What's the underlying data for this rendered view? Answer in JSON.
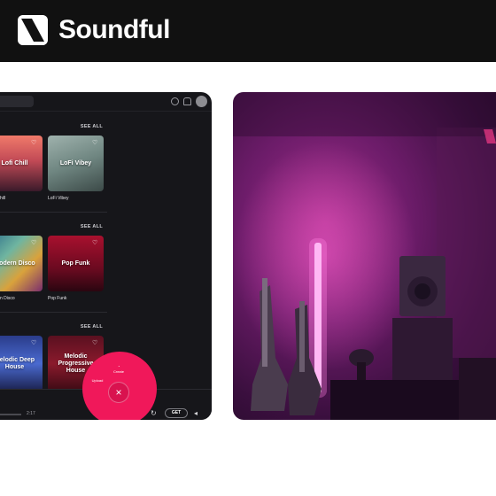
{
  "brand": {
    "name": "Soundful",
    "logo_icon": "soundful-s-logo"
  },
  "app": {
    "top_bar": {
      "icons": [
        "help-icon",
        "bell-icon",
        "avatar"
      ]
    },
    "sections": [
      {
        "see_all": "SEE ALL",
        "cards": [
          {
            "title": "Lofi Chill",
            "caption": "hill"
          },
          {
            "title": "LoFi Vibey",
            "caption": "LoFi Vibey"
          }
        ]
      },
      {
        "see_all": "SEE ALL",
        "cards": [
          {
            "title": "Modern Disco",
            "caption": "n Disco"
          },
          {
            "title": "Pop Funk",
            "caption": "Pop Funk"
          }
        ]
      },
      {
        "see_all": "SEE ALL",
        "cards": [
          {
            "title": "Melodic Deep House",
            "caption": ""
          },
          {
            "title": "Melodic Progressive House",
            "caption": ""
          }
        ]
      }
    ],
    "player": {
      "time": "2:17",
      "get_label": "GET"
    },
    "fab": {
      "upper_label": "Create",
      "lower_label": "Upload",
      "close_glyph": "×"
    }
  },
  "photo": {
    "subject": "music-studio-image"
  },
  "colors": {
    "accent": "#f0185a",
    "header_bg": "#111111",
    "app_bg": "#16161a"
  }
}
